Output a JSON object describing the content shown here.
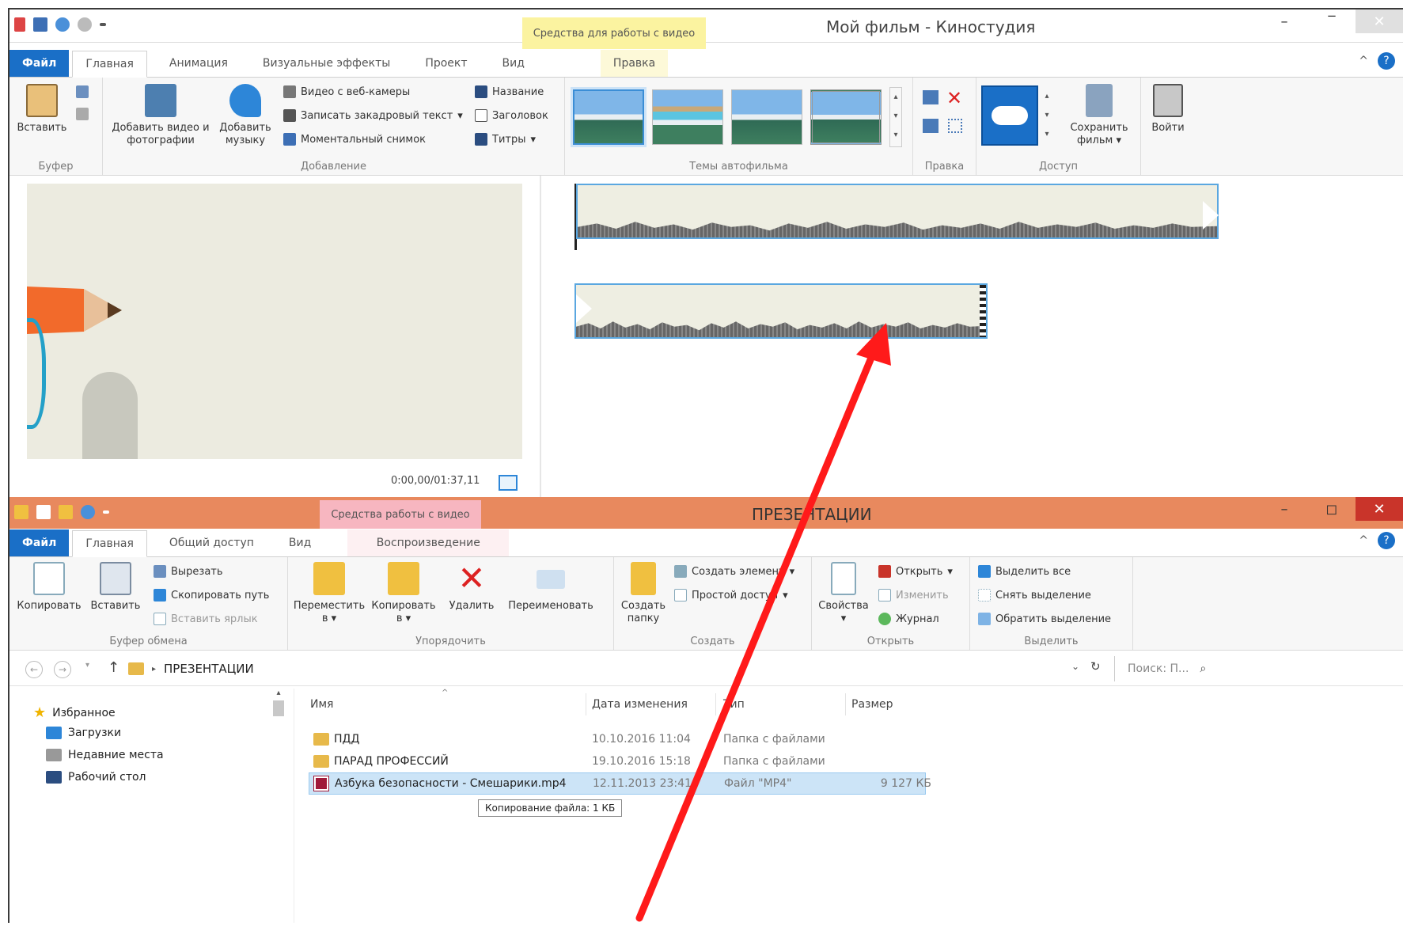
{
  "movie_maker": {
    "title": "Мой фильм - Киностудия",
    "context_tab": "Средства для работы с видео",
    "tabs": [
      "Файл",
      "Главная",
      "Анимация",
      "Визуальные эффекты",
      "Проект",
      "Вид",
      "Правка"
    ],
    "groups": {
      "clipboard": {
        "label": "Буфер",
        "paste": "Вставить"
      },
      "add": {
        "label": "Добавление",
        "add_video": "Добавить видео и фотографии",
        "add_music": "Добавить музыку",
        "webcam": "Видео с веб-камеры",
        "narration": "Записать закадровый текст",
        "snapshot": "Моментальный снимок",
        "caption": "Название",
        "title_btn": "Заголовок",
        "credits": "Титры"
      },
      "themes": {
        "label": "Темы автофильма"
      },
      "edit": {
        "label": "Правка"
      },
      "share": {
        "label": "Доступ",
        "save": "Сохранить фильм"
      },
      "signin": {
        "label": "Войти"
      }
    },
    "timecode": "0:00,00/01:37,11"
  },
  "explorer": {
    "title": "ПРЕЗЕНТАЦИИ",
    "context_tab": "Средства работы с видео",
    "tabs": [
      "Файл",
      "Главная",
      "Общий доступ",
      "Вид",
      "Воспроизведение"
    ],
    "groups": {
      "clipboard": {
        "label": "Буфер обмена",
        "copy": "Копировать",
        "paste": "Вставить",
        "cut": "Вырезать",
        "copy_path": "Скопировать путь",
        "paste_shortcut": "Вставить ярлык"
      },
      "organize": {
        "label": "Упорядочить",
        "move": "Переместить в",
        "copy_to": "Копировать в",
        "delete": "Удалить",
        "rename": "Переименовать"
      },
      "create": {
        "label": "Создать",
        "new_folder": "Создать папку",
        "new_item": "Создать элемент",
        "easy_access": "Простой доступ"
      },
      "open": {
        "label": "Открыть",
        "properties": "Свойства",
        "open": "Открыть",
        "edit": "Изменить",
        "history": "Журнал"
      },
      "select": {
        "label": "Выделить",
        "select_all": "Выделить все",
        "select_none": "Снять выделение",
        "invert": "Обратить выделение"
      }
    },
    "address": {
      "path": "ПРЕЗЕНТАЦИИ",
      "search_placeholder": "Поиск: П..."
    },
    "nav": {
      "favorites": "Избранное",
      "downloads": "Загрузки",
      "recent": "Недавние места",
      "desktop": "Рабочий стол"
    },
    "columns": {
      "name": "Имя",
      "date": "Дата изменения",
      "type": "Тип",
      "size": "Размер"
    },
    "rows": [
      {
        "name": "ПДД",
        "date": "10.10.2016 11:04",
        "type": "Папка с файлами",
        "size": ""
      },
      {
        "name": "ПАРАД ПРОФЕССИЙ",
        "date": "19.10.2016 15:18",
        "type": "Папка с файлами",
        "size": ""
      },
      {
        "name": "Азбука безопасности - Смешарики.mp4",
        "date": "12.11.2013 23:41",
        "type": "Файл \"MP4\"",
        "size": "9 127 КБ"
      }
    ],
    "drag_tooltip": "Копирование файла: 1 КБ"
  },
  "colors": {
    "accent_blue": "#1a6fc7",
    "explorer_title": "#e8895e",
    "arrow": "#ff1a1a"
  }
}
